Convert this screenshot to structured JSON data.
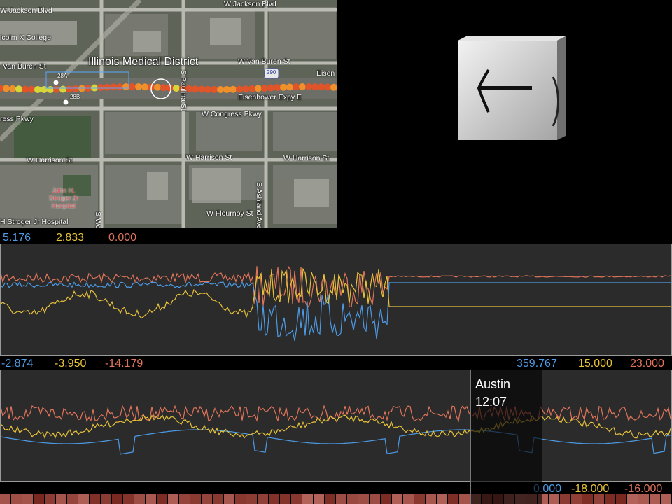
{
  "map": {
    "district_label": "Illinois Medical District",
    "streets": [
      "W Jackson Blvd",
      "W Jackson Blvd",
      "lcolm X College",
      "Van Buren St",
      "W Van Buren St",
      "Eisen",
      "Eisenhower Expy E",
      "ress Pkwy",
      "W Congress Pkwy",
      "W Harrison St",
      "W Harrison St",
      "W Harrison St",
      "W Flournoy St",
      "S Ashland Ave",
      "S Paulina St",
      "S Wo",
      "H Stroger Jr Hospital"
    ],
    "hospital": [
      "John H.",
      "Stroger Jr",
      "Hospital"
    ],
    "exit_label": "28A",
    "exit_label_2": "28B",
    "highway_shield": "290"
  },
  "direction": {
    "arrow": "left-arrow-icon"
  },
  "chart1": {
    "values": [
      "5.176",
      "2.833",
      "0.000"
    ],
    "min_values": [
      "-2.874",
      "-3.950",
      "-14.179"
    ]
  },
  "chart2": {
    "values": [
      "359.767",
      "15.000",
      "23.000"
    ],
    "min_values": [
      "0.000",
      "-18.000",
      "-16.000"
    ]
  },
  "tooltip": {
    "place": "Austin",
    "time": "12:07"
  },
  "colors": {
    "blue": "#4d9be6",
    "yellow": "#e8c33a",
    "red": "#e0745a"
  }
}
